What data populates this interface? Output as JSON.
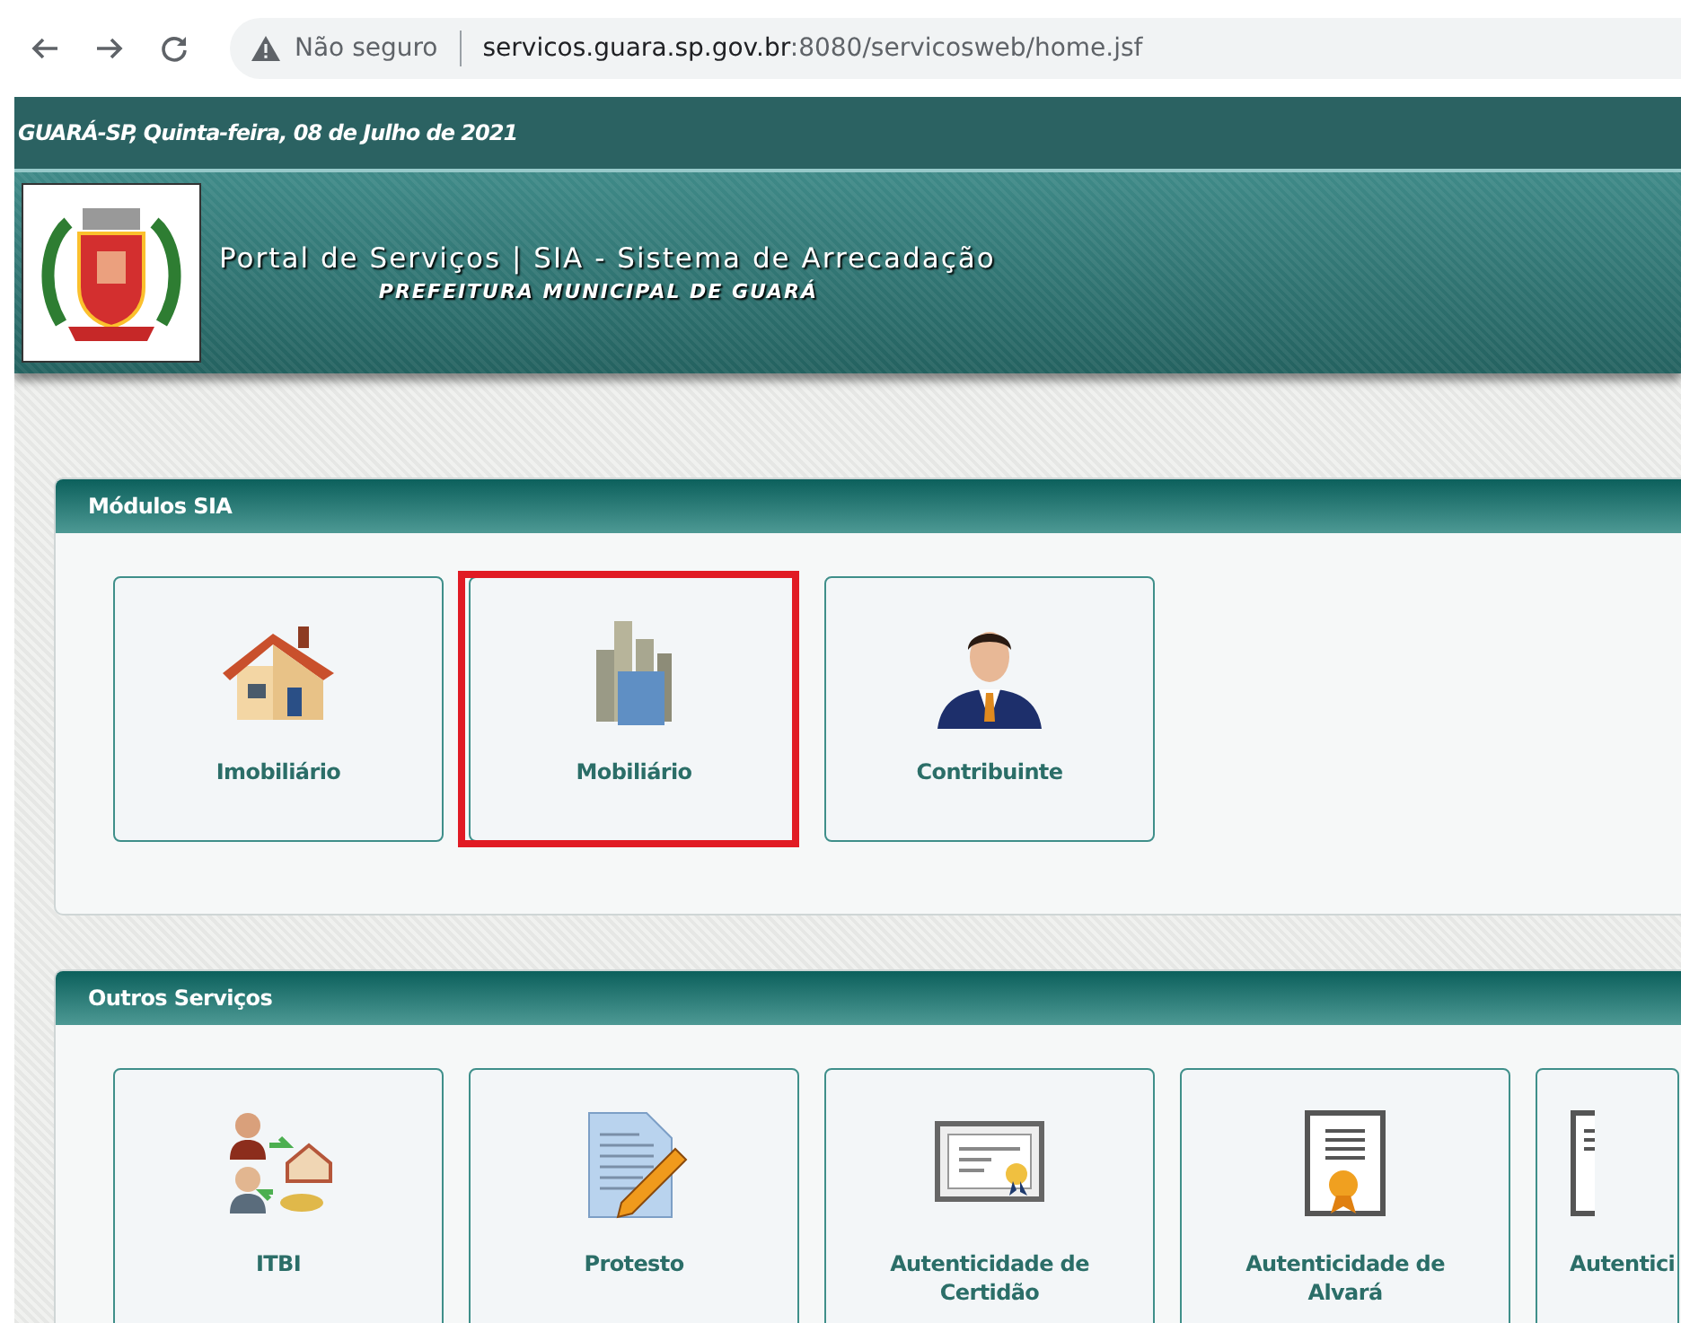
{
  "browser": {
    "security_label": "Não seguro",
    "url_host": "servicos.guara.sp.gov.br",
    "url_rest": ":8080/servicosweb/home.jsf"
  },
  "date_bar": "GUARÁ-SP, Quinta-feira, 08 de Julho de 2021",
  "banner": {
    "title": "Portal de Serviços | SIA - Sistema de Arrecadação",
    "subtitle": "PREFEITURA MUNICIPAL DE GUARÁ"
  },
  "sections": [
    {
      "title": "Módulos SIA",
      "tiles": [
        {
          "label": "Imobiliário",
          "kind": "house",
          "highlighted": false
        },
        {
          "label": "Mobiliário",
          "kind": "buildings",
          "highlighted": true
        },
        {
          "label": "Contribuinte",
          "kind": "person",
          "highlighted": false
        }
      ]
    },
    {
      "title": "Outros Serviços",
      "tiles": [
        {
          "label": "ITBI",
          "kind": "transfer",
          "highlighted": false
        },
        {
          "label": "Protesto",
          "kind": "document",
          "highlighted": false
        },
        {
          "label": "Autenticidade de Certidão",
          "kind": "certificate",
          "highlighted": false
        },
        {
          "label": "Autenticidade de Alvará",
          "kind": "award",
          "highlighted": false
        },
        {
          "label": "Autentici",
          "kind": "partial",
          "highlighted": false
        }
      ]
    }
  ]
}
